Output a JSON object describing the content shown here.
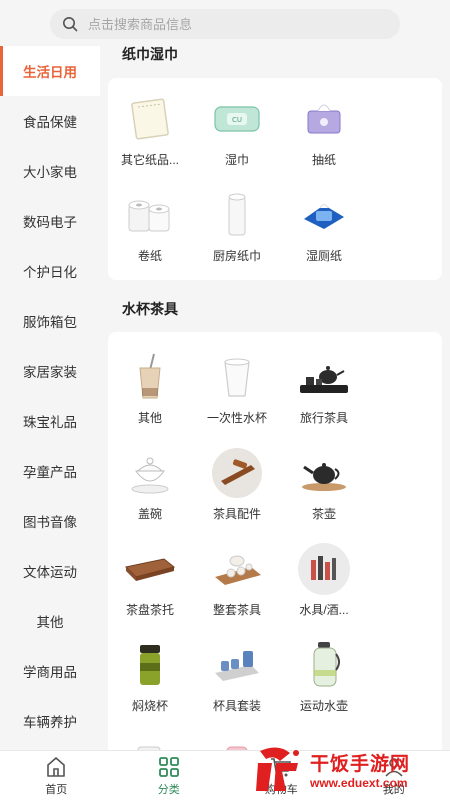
{
  "search": {
    "placeholder": "点击搜索商品信息"
  },
  "sidebar": {
    "items": [
      {
        "label": "生活日用",
        "active": true
      },
      {
        "label": "食品保健"
      },
      {
        "label": "大小家电"
      },
      {
        "label": "数码电子"
      },
      {
        "label": "个护日化"
      },
      {
        "label": "服饰箱包"
      },
      {
        "label": "家居家装"
      },
      {
        "label": "珠宝礼品"
      },
      {
        "label": "孕童产品"
      },
      {
        "label": "图书音像"
      },
      {
        "label": "文体运动"
      },
      {
        "label": "其他"
      },
      {
        "label": "学商用品"
      },
      {
        "label": "车辆养护"
      }
    ]
  },
  "sections": [
    {
      "title": "纸巾湿巾",
      "items": [
        {
          "label": "其它纸品...",
          "icon": "paper-sheet-icon"
        },
        {
          "label": "湿巾",
          "icon": "wet-wipes-icon"
        },
        {
          "label": "抽纸",
          "icon": "tissue-box-icon"
        },
        {
          "label": "卷纸",
          "icon": "toilet-roll-icon"
        },
        {
          "label": "厨房纸巾",
          "icon": "kitchen-roll-icon"
        },
        {
          "label": "湿厕纸",
          "icon": "toilet-wipes-icon"
        }
      ]
    },
    {
      "title": "水杯茶具",
      "items": [
        {
          "label": "其他",
          "icon": "milk-tea-icon"
        },
        {
          "label": "一次性水杯",
          "icon": "paper-cup-icon"
        },
        {
          "label": "旅行茶具",
          "icon": "travel-tea-set-icon"
        },
        {
          "label": "盖碗",
          "icon": "lidded-bowl-icon"
        },
        {
          "label": "茶具配件",
          "icon": "tea-tools-icon"
        },
        {
          "label": "茶壶",
          "icon": "teapot-icon"
        },
        {
          "label": "茶盘茶托",
          "icon": "tea-tray-icon"
        },
        {
          "label": "整套茶具",
          "icon": "full-tea-set-icon"
        },
        {
          "label": "水具/酒...",
          "icon": "drinkware-icon"
        },
        {
          "label": "焖烧杯",
          "icon": "thermos-cup-icon"
        },
        {
          "label": "杯具套装",
          "icon": "cup-set-icon"
        },
        {
          "label": "运动水壶",
          "icon": "sports-bottle-icon"
        }
      ]
    }
  ],
  "tabbar": {
    "items": [
      {
        "label": "首页",
        "icon": "home-icon"
      },
      {
        "label": "分类",
        "icon": "category-icon",
        "active": true
      },
      {
        "label": "购物车",
        "icon": "cart-icon"
      },
      {
        "label": "我的",
        "icon": "profile-icon"
      }
    ]
  },
  "watermark": {
    "title": "干饭手游网",
    "url": "www.eduext.com"
  },
  "colors": {
    "accent": "#e8643a",
    "tab_active": "#2e8b57",
    "watermark": "#e02020"
  }
}
